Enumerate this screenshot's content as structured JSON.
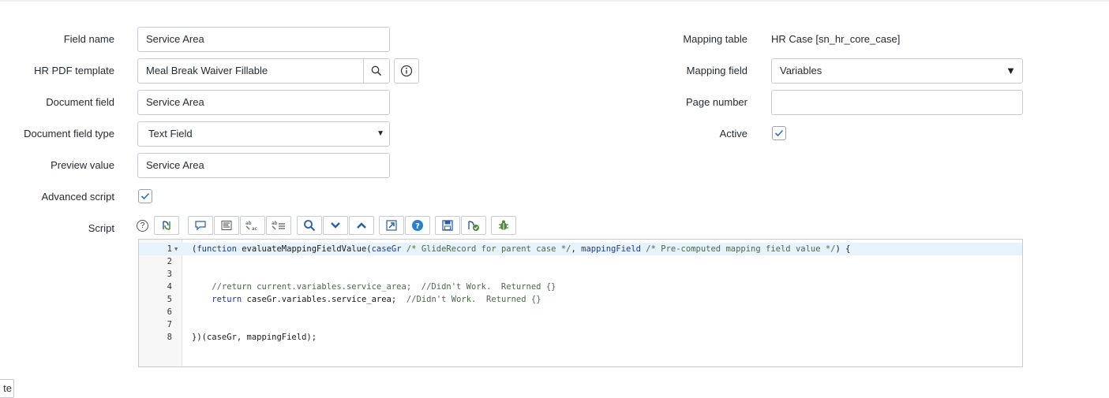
{
  "form": {
    "field_name": {
      "label": "Field name",
      "value": "Service Area"
    },
    "hr_pdf_template": {
      "label": "HR PDF template",
      "value": "Meal Break Waiver Fillable"
    },
    "document_field": {
      "label": "Document field",
      "value": "Service Area"
    },
    "document_field_type": {
      "label": "Document field type",
      "value": "Text Field"
    },
    "preview_value": {
      "label": "Preview value",
      "value": "Service Area"
    },
    "advanced_script": {
      "label": "Advanced script",
      "checked": true
    },
    "script": {
      "label": "Script"
    },
    "mapping_table": {
      "label": "Mapping table",
      "value": "HR Case [sn_hr_core_case]"
    },
    "mapping_field": {
      "label": "Mapping field",
      "value": "Variables"
    },
    "page_number": {
      "label": "Page number",
      "value": ""
    },
    "active": {
      "label": "Active",
      "checked": true
    }
  },
  "toolbar": {
    "help": "?",
    "icons": [
      "toggle-script-icon",
      "comment-icon",
      "format-icon",
      "replace-icon",
      "replace-all-icon",
      "search-icon",
      "next-icon",
      "previous-icon",
      "fullscreen-icon",
      "help-icon",
      "save-icon",
      "script-check-icon",
      "debug-icon"
    ]
  },
  "editor": {
    "lines": [
      {
        "num": "1",
        "segments": [
          {
            "t": "(",
            "c": "p"
          },
          {
            "t": "function",
            "c": "kw"
          },
          {
            "t": " evaluateMappingFieldValue(",
            "c": "p"
          },
          {
            "t": "caseGr",
            "c": "vr"
          },
          {
            "t": " /* GlideRecord for parent case */",
            "c": "cm"
          },
          {
            "t": ", ",
            "c": "p"
          },
          {
            "t": "mappingField",
            "c": "vr"
          },
          {
            "t": " /* Pre-computed mapping field value */",
            "c": "cm"
          },
          {
            "t": ") {",
            "c": "p"
          }
        ]
      },
      {
        "num": "2",
        "segments": []
      },
      {
        "num": "3",
        "segments": []
      },
      {
        "num": "4",
        "segments": [
          {
            "t": "    //return current.variables.service_area;  //Didn't Work.  Returned {}",
            "c": "cm"
          }
        ]
      },
      {
        "num": "5",
        "segments": [
          {
            "t": "    ",
            "c": "p"
          },
          {
            "t": "return",
            "c": "kw"
          },
          {
            "t": " caseGr.variables.service_area;  ",
            "c": "p"
          },
          {
            "t": "//Didn't Work.  Returned {}",
            "c": "cm"
          }
        ]
      },
      {
        "num": "6",
        "segments": []
      },
      {
        "num": "7",
        "segments": []
      },
      {
        "num": "8",
        "segments": [
          {
            "t": "})(caseGr, mappingField);",
            "c": "p"
          }
        ]
      }
    ]
  },
  "bottom_fragment": "te"
}
